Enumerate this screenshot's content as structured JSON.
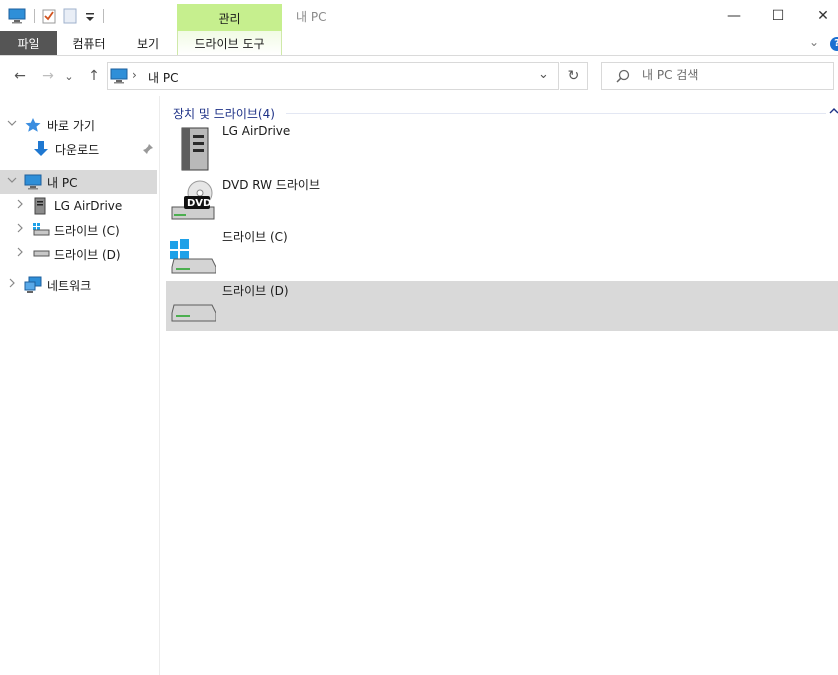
{
  "window": {
    "title": "내 PC",
    "context_tab": "관리",
    "minimize": "—",
    "maximize": "☐",
    "close": "✕"
  },
  "ribbon": {
    "tabs": [
      "파일",
      "컴퓨터",
      "보기"
    ],
    "context_tab": "드라이브 도구",
    "expand": "⌄",
    "help": "?"
  },
  "nav": {
    "back": "←",
    "forward": "→",
    "recent": "⌄",
    "up": "↑"
  },
  "address": {
    "separator": "›",
    "location": "내 PC",
    "dropdown": "⌄",
    "refresh": "↻"
  },
  "search": {
    "placeholder": "내 PC 검색"
  },
  "navpane": {
    "quick_access": "바로 가기",
    "downloads": "다운로드",
    "this_pc": "내 PC",
    "lg_airdrive": "LG AirDrive",
    "drive_c": "드라이브 (C)",
    "drive_d": "드라이브 (D)",
    "network": "네트워크"
  },
  "content": {
    "group_title": "장치 및 드라이브",
    "group_count": "(4)",
    "drives": [
      {
        "label": "LG AirDrive",
        "icon": "server-drive-icon"
      },
      {
        "label": "DVD RW 드라이브",
        "icon": "dvd-drive-icon",
        "badge": "DVD"
      },
      {
        "label": "드라이브 (C)",
        "icon": "windows-drive-icon"
      },
      {
        "label": "드라이브 (D)",
        "icon": "hard-drive-icon"
      }
    ]
  },
  "colors": {
    "context_tab": "#c6ef8e",
    "file_tab": "#555555",
    "group_title": "#1e3287",
    "selected": "#d9d9d9",
    "accent": "#1a6fd1"
  }
}
